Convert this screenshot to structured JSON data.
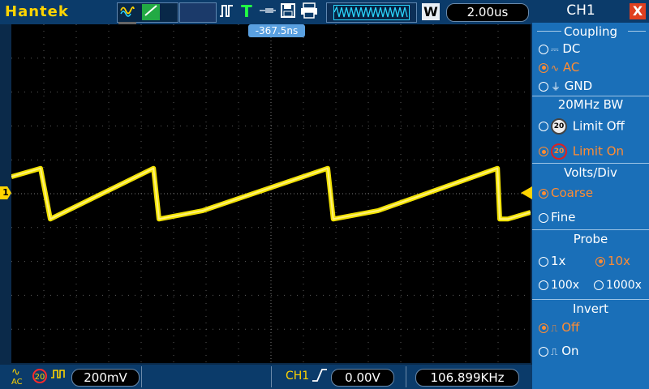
{
  "brand": "Hantek",
  "top_bar": {
    "mode_icons": [
      "sine-wave-icon",
      "ramp-wave-icon",
      "persistence-icon"
    ],
    "timebase_mode": "W",
    "timebase": "2.00us"
  },
  "screen": {
    "trigger_position": "-367.5ns",
    "ch1_marker": "1"
  },
  "bottom_bar": {
    "coupling": "AC",
    "bw_limit": "20",
    "volts_div": "200mV",
    "trigger_source": "CH1",
    "trigger_level": "0.00V",
    "frequency": "106.899KHz"
  },
  "panel": {
    "title": "CH1",
    "close": "X",
    "coupling": {
      "title": "Coupling",
      "options": [
        {
          "label": "DC",
          "selected": false
        },
        {
          "label": "AC",
          "selected": true
        },
        {
          "label": "GND",
          "selected": false
        }
      ]
    },
    "bw": {
      "title": "20MHz BW",
      "badge": "20",
      "options": [
        {
          "label": "Limit Off",
          "selected": false
        },
        {
          "label": "Limit On",
          "selected": true
        }
      ]
    },
    "volts": {
      "title": "Volts/Div",
      "options": [
        {
          "label": "Coarse",
          "selected": true
        },
        {
          "label": "Fine",
          "selected": false
        }
      ]
    },
    "probe": {
      "title": "Probe",
      "options": [
        {
          "label": "1x",
          "selected": false
        },
        {
          "label": "10x",
          "selected": true
        },
        {
          "label": "100x",
          "selected": false
        },
        {
          "label": "1000x",
          "selected": false
        }
      ]
    },
    "invert": {
      "title": "Invert",
      "options": [
        {
          "label": "Off",
          "selected": true
        },
        {
          "label": "On",
          "selected": false
        }
      ]
    }
  },
  "colors": {
    "trace": "#ffee00",
    "selected": "#ff8c33",
    "panel_bg": "#1a6fb8",
    "bar_bg": "#0b3b6a"
  },
  "chart_data": {
    "type": "line",
    "title": "",
    "xlabel": "",
    "ylabel": "",
    "x_divisions": 16,
    "y_divisions": 10,
    "grid": true,
    "series": [
      {
        "x": [
          0,
          0.9,
          1.2,
          4.38,
          4.55,
          5.9,
          9.75,
          9.92,
          11.3,
          14.98,
          15.05,
          15.3,
          16
        ],
        "y": [
          0.5,
          0.75,
          -0.75,
          0.75,
          -0.75,
          -0.5,
          0.75,
          -0.75,
          -0.5,
          0.75,
          -0.75,
          -0.75,
          -0.55
        ]
      }
    ]
  }
}
